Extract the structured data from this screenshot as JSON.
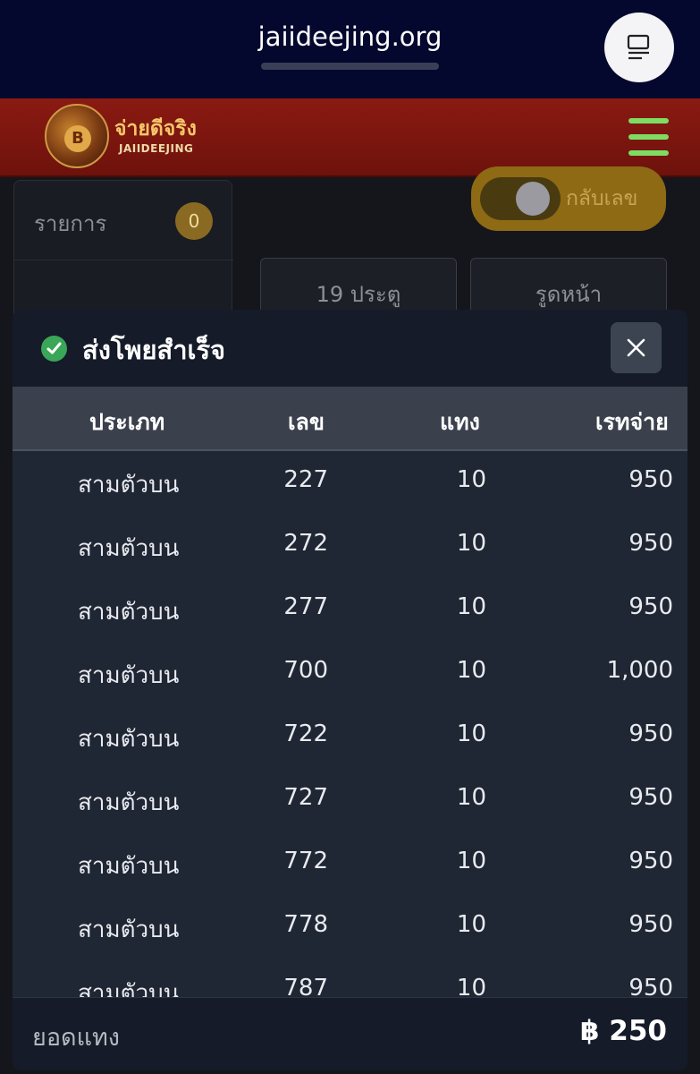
{
  "browser": {
    "url": "jaiideejing.org",
    "reader_icon": "reader-view-icon"
  },
  "header": {
    "logo_thai": "จ่ายดีจริง",
    "logo_en": "JAIIDEEJING",
    "logo_coin": "B",
    "menu_icon": "hamburger-menu-icon"
  },
  "background": {
    "list_label": "รายการ",
    "list_count": "0",
    "toggle_label": "กลับเลข",
    "tabs": [
      "19 ประตู",
      "รูดหน้า"
    ]
  },
  "modal": {
    "title": "ส่งโพยสำเร็จ",
    "status_icon": "check-circle-icon",
    "close_icon": "close-icon",
    "columns": [
      "ประเภท",
      "เลข",
      "แทง",
      "เรทจ่าย"
    ],
    "rows": [
      {
        "type": "สามตัวบน",
        "number": "227",
        "bet": "10",
        "rate": "950"
      },
      {
        "type": "สามตัวบน",
        "number": "272",
        "bet": "10",
        "rate": "950"
      },
      {
        "type": "สามตัวบน",
        "number": "277",
        "bet": "10",
        "rate": "950"
      },
      {
        "type": "สามตัวบน",
        "number": "700",
        "bet": "10",
        "rate": "1,000"
      },
      {
        "type": "สามตัวบน",
        "number": "722",
        "bet": "10",
        "rate": "950"
      },
      {
        "type": "สามตัวบน",
        "number": "727",
        "bet": "10",
        "rate": "950"
      },
      {
        "type": "สามตัวบน",
        "number": "772",
        "bet": "10",
        "rate": "950"
      },
      {
        "type": "สามตัวบน",
        "number": "778",
        "bet": "10",
        "rate": "950"
      },
      {
        "type": "สามตัวบน",
        "number": "787",
        "bet": "10",
        "rate": "950"
      }
    ],
    "footer_label": "ยอดแทง",
    "footer_total": "฿ 250"
  },
  "colors": {
    "browser_bg": "#04082e",
    "header_red": "#8a1a12",
    "menu_green": "#7fdc63",
    "modal_bg": "#1f2634",
    "success_green": "#3aa657"
  }
}
